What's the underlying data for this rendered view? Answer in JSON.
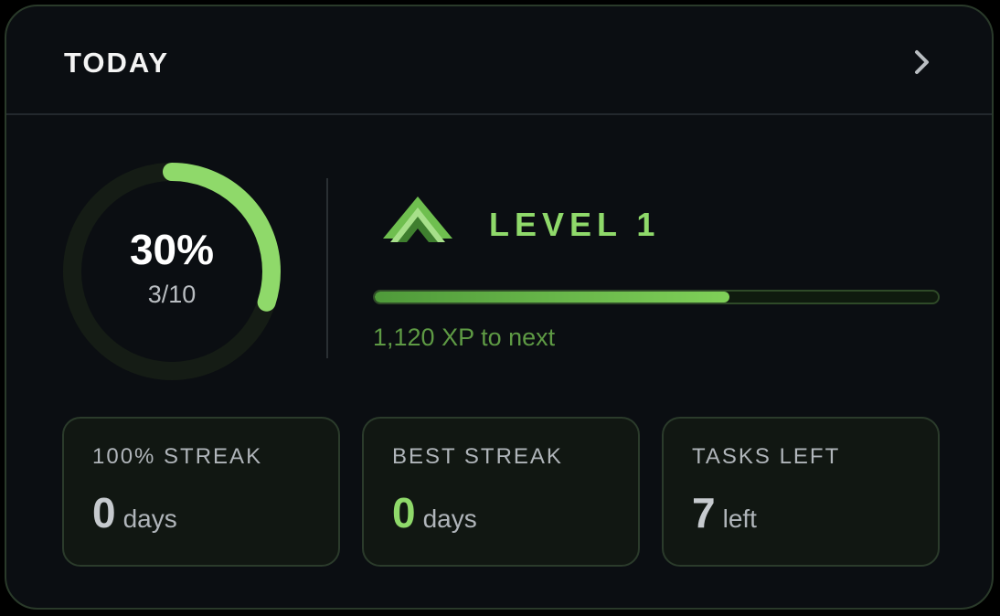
{
  "header": {
    "title": "TODAY",
    "chevron_icon": "chevron-right-icon"
  },
  "progress": {
    "percent_label": "30%",
    "count_label": "3/10",
    "fraction": 0.3
  },
  "level": {
    "icon": "double-chevron-up-icon",
    "label": "LEVEL 1",
    "xp_fraction": 0.63,
    "xp_to_next": "1,120 XP to next"
  },
  "stats": [
    {
      "label": "100% STREAK",
      "value": "0",
      "unit": "days"
    },
    {
      "label": "BEST STREAK",
      "value": "0",
      "unit": "days"
    },
    {
      "label": "TASKS LEFT",
      "value": "7",
      "unit": "left"
    }
  ],
  "colors": {
    "accent_green": "#8fd96a",
    "card_background": "#0b0e12",
    "ring_track": "#151c15"
  }
}
